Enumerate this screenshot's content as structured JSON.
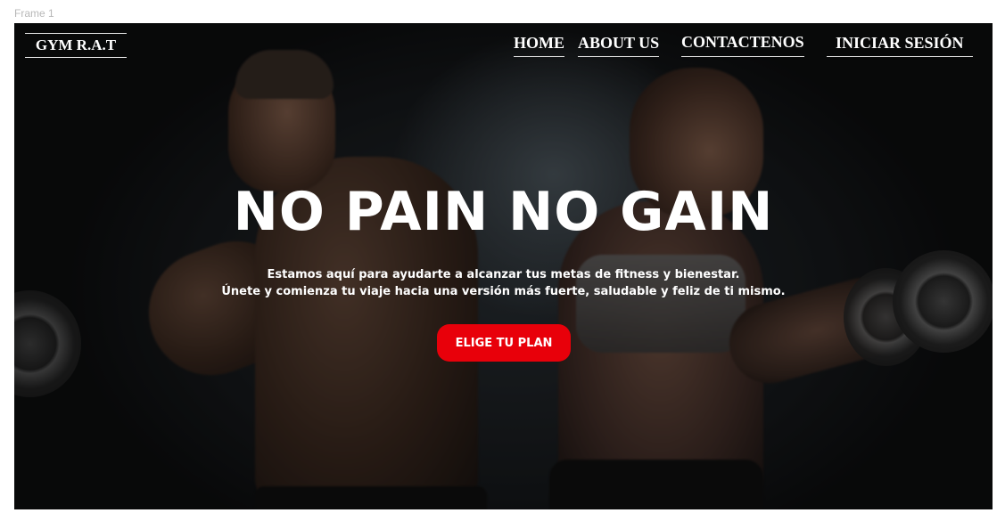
{
  "canvas": {
    "frame_label": "Frame 1"
  },
  "navbar": {
    "brand": "GYM R.A.T",
    "links": [
      {
        "label": "HOME"
      },
      {
        "label": "ABOUT US"
      },
      {
        "label": "CONTACTENOS"
      },
      {
        "label": "INICIAR SESIÓN"
      }
    ]
  },
  "hero": {
    "title": "NO PAIN NO GAIN",
    "subtitle_line1": "Estamos aquí para ayudarte a alcanzar tus metas de fitness y bienestar.",
    "subtitle_line2": "Únete y comienza tu viaje hacia una versión más fuerte, saludable y feliz de ti mismo.",
    "cta_label": "ELIGE TU PLAN"
  },
  "colors": {
    "accent": "#e8000a",
    "text": "#ffffff",
    "background": "#101010"
  }
}
